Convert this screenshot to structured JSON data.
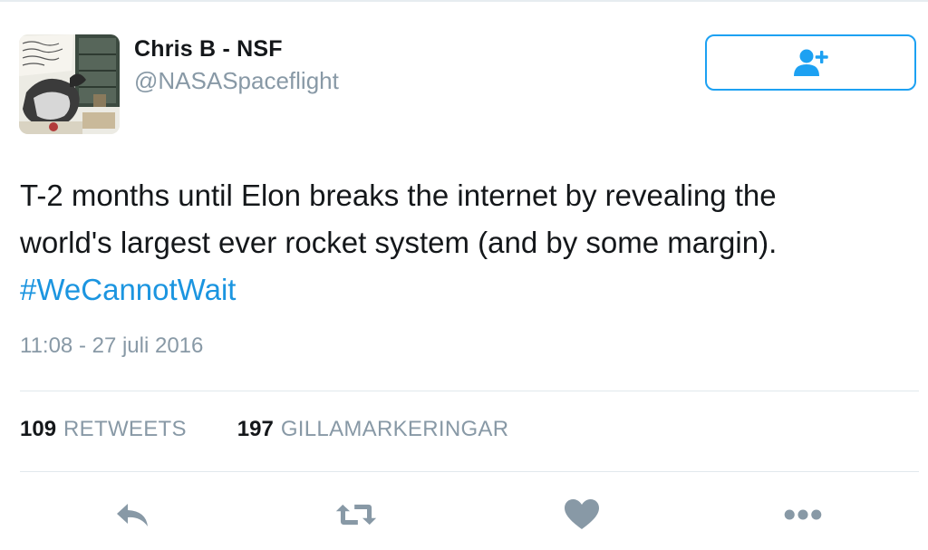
{
  "user": {
    "name": "Chris B - NSF",
    "handle": "@NASASpaceflight"
  },
  "follow_button": {
    "icon": "add-user-icon",
    "color": "#1da1f2"
  },
  "tweet": {
    "lines": [
      "T-2 months until Elon breaks the internet by revealing the",
      "world's largest ever rocket system (and by some margin)."
    ],
    "hashtag": "#WeCannotWait",
    "timestamp": "11:08 - 27 juli 2016"
  },
  "stats": {
    "retweets_count": "109",
    "retweets_label": "RETWEETS",
    "likes_count": "197",
    "likes_label": "GILLAMARKERINGAR"
  },
  "actions": [
    {
      "icon": "reply-icon"
    },
    {
      "icon": "retweet-icon"
    },
    {
      "icon": "heart-icon"
    },
    {
      "icon": "more-icon"
    }
  ],
  "colors": {
    "accent": "#1da1f2",
    "link": "#1b95e0",
    "muted": "#8899a6",
    "icon": "#8899a6"
  }
}
